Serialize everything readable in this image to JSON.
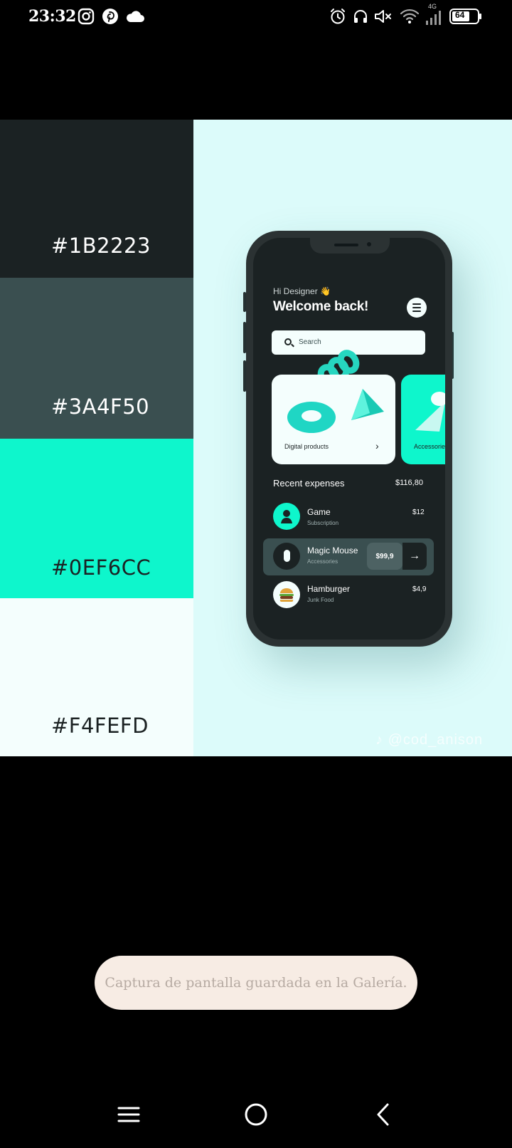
{
  "status_bar": {
    "time": "23:32",
    "left_icons": [
      "instagram-icon",
      "pinterest-icon",
      "cloud-icon"
    ],
    "right_icons": [
      "alarm-icon",
      "headphones-icon",
      "muted-speaker-icon",
      "wifi-icon",
      "signal-icon",
      "battery-icon"
    ],
    "network": "4G",
    "battery": "64"
  },
  "palette": {
    "swatches": [
      {
        "label": "#1B2223",
        "color": "#1B2223",
        "text_color": "#ffffff"
      },
      {
        "label": "#3A4F50",
        "color": "#3A4F50",
        "text_color": "#ffffff"
      },
      {
        "label": "#0EF6CC",
        "color": "#0EF6CC",
        "text_color": "#1B2223"
      },
      {
        "label": "#F4FEFD",
        "color": "#F4FEFD",
        "text_color": "#1B2223"
      }
    ]
  },
  "mockup": {
    "greeting": "Hi Designer 👋",
    "title": "Welcome back!",
    "search_placeholder": "Search",
    "categories": [
      {
        "label": "Digital products"
      },
      {
        "label": "Accessories"
      }
    ],
    "recent": {
      "title": "Recent expenses",
      "total": "$116,80",
      "items": [
        {
          "name": "Game",
          "sub": "Subscription",
          "amount": "$12"
        },
        {
          "name": "Magic Mouse",
          "sub": "Accessories",
          "amount": "$99,9"
        },
        {
          "name": "Hamburger",
          "sub": "Junk Food",
          "amount": "$4,9"
        }
      ]
    },
    "watermark": "@cod_anison"
  },
  "toast": {
    "message": "Captura de pantalla guardada en la Galería."
  },
  "navbar": {
    "icons": [
      "menu-icon",
      "home-icon",
      "back-icon"
    ]
  }
}
